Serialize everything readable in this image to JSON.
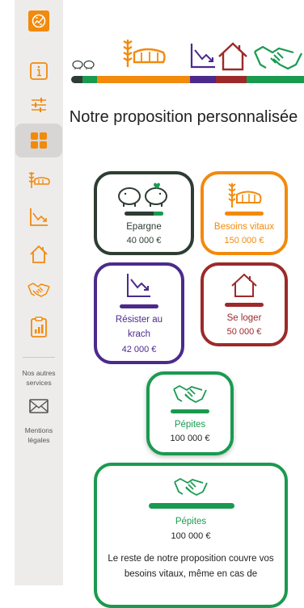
{
  "colors": {
    "orange": "#f28a0c",
    "dark_green": "#2e3d33",
    "purple": "#4c2a8c",
    "red": "#9c2a2a",
    "green": "#1a9a50"
  },
  "sidebar": {
    "items": [
      {
        "icon": "info-icon"
      },
      {
        "icon": "sliders-icon"
      },
      {
        "icon": "grid-icon"
      },
      {
        "icon": "bread-icon"
      },
      {
        "icon": "chart-down-icon"
      },
      {
        "icon": "house-icon"
      },
      {
        "icon": "handshake-icon"
      },
      {
        "icon": "clipboard-chart-icon"
      }
    ],
    "other_services_label": "Nos autres services",
    "legal_label": "Mentions légales"
  },
  "page": {
    "title": "Notre proposition personnalisée"
  },
  "cards": {
    "epargne": {
      "label": "Epargne",
      "amount": "40 000 €"
    },
    "besoins": {
      "label": "Besoins vitaux",
      "amount": "150 000 €"
    },
    "krach": {
      "label": "Résister au krach",
      "amount": "42 000 €"
    },
    "loger": {
      "label": "Se loger",
      "amount": "50 000 €"
    },
    "pepites": {
      "label": "Pépites",
      "amount": "100 000 €"
    },
    "pepites_detail": {
      "label": "Pépites",
      "amount": "100 000 €",
      "description": "Le reste de notre proposition couvre vos besoins vitaux, même en cas de"
    }
  }
}
